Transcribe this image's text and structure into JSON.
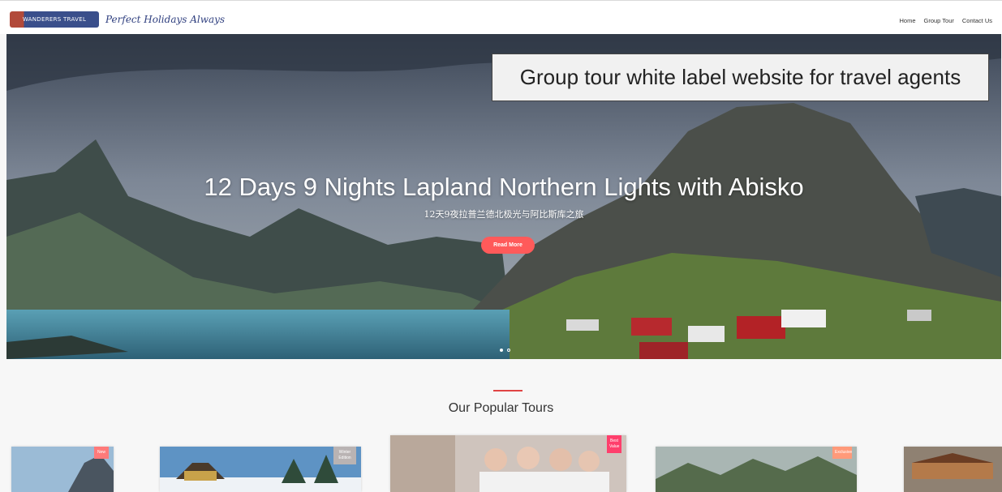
{
  "header": {
    "logo_text": "WANDERERS TRAVEL",
    "tagline": "Perfect Holidays Always",
    "nav": [
      "Home",
      "Group Tour",
      "Contact Us"
    ]
  },
  "hero": {
    "annotation": "Group tour white label website for travel agents",
    "title": "12 Days 9 Nights Lapland Northern Lights with Abisko",
    "subtitle": "12天9夜拉普兰德北极光与阿比斯库之旅",
    "cta_label": "Read More",
    "slides": 2,
    "active_slide": 1
  },
  "popular": {
    "title": "Our Popular Tours",
    "cards": [
      {
        "badge": "New",
        "badge_color": "#ff7a7a"
      },
      {
        "badge": "Winter Edition",
        "badge_color": "#b9b3b3"
      },
      {
        "badge": "Best Value",
        "badge_color": "#ff3f6c"
      },
      {
        "badge": "Exclusive",
        "badge_color": "#ff9a7a"
      }
    ]
  },
  "colors": {
    "accent": "#ff5a5a",
    "sky": "#5e6a79",
    "water": "#4c8fa6"
  }
}
